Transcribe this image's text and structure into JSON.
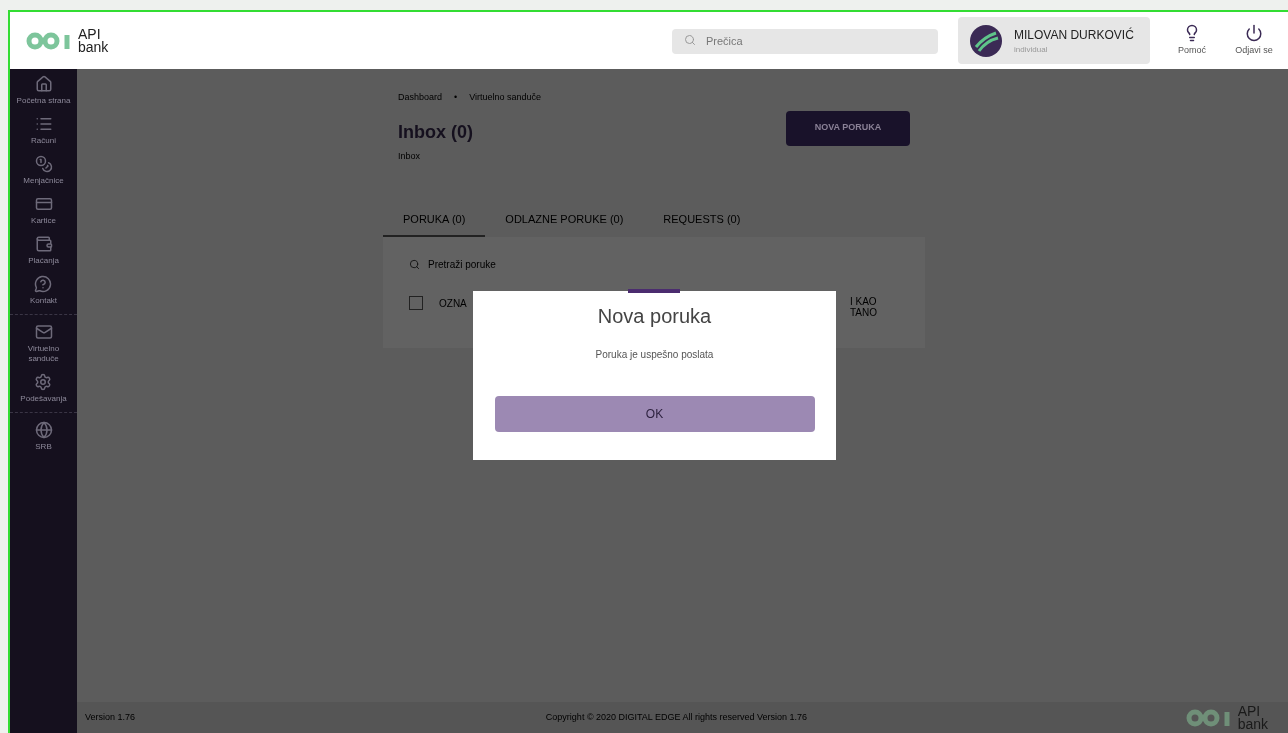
{
  "header": {
    "logo_text": [
      "API",
      "bank"
    ],
    "search": {
      "placeholder": "Prečica"
    },
    "user": {
      "name": "MILOVAN DURKOVIĆ",
      "subtitle": "individual"
    },
    "actions": [
      {
        "kind": "help",
        "label": "Pomoć"
      },
      {
        "kind": "logout",
        "label": "Odjavi se"
      }
    ]
  },
  "sidebar": {
    "groups": [
      {
        "items": [
          {
            "label": "Početna strana"
          },
          {
            "label": "Računi"
          },
          {
            "label": "Menjačnice"
          },
          {
            "label": "Kartice"
          },
          {
            "label": "Plaćanja"
          },
          {
            "label": "Kontakt"
          }
        ]
      },
      {
        "items": [
          {
            "label": "Virtuelno sanduče"
          },
          {
            "label": "Podešavanja"
          }
        ]
      },
      {
        "items": [
          {
            "label": "SRB"
          }
        ]
      }
    ]
  },
  "breadcrumb": {
    "items": [
      "Dashboard",
      "Virtuelno sanduče"
    ],
    "separator": "•"
  },
  "page": {
    "title": "Inbox (0)",
    "subtitle": "Inbox",
    "button": "NOVA PORUKA"
  },
  "tabs": [
    {
      "label": "PORUKA (0)",
      "selected": true
    },
    {
      "label": "ODLAZNE PORUKE (0)",
      "selected": false
    },
    {
      "label": "REQUESTS (0)",
      "selected": false
    }
  ],
  "message_search": {
    "placeholder": "Pretraži poruke"
  },
  "select_row": {
    "checked": false,
    "left_text": "OZNA",
    "right_lines": [
      "I KAO",
      "TANO"
    ]
  },
  "modal": {
    "title": "Nova poruka",
    "message": "Poruka je uspešno poslata",
    "button": "OK"
  },
  "footer": {
    "version": "Version 1.76",
    "copyright": "Copyright © 2020 DIGITAL EDGE All rights reserved Version 1.76",
    "logo_text": [
      "API",
      "bank"
    ]
  }
}
